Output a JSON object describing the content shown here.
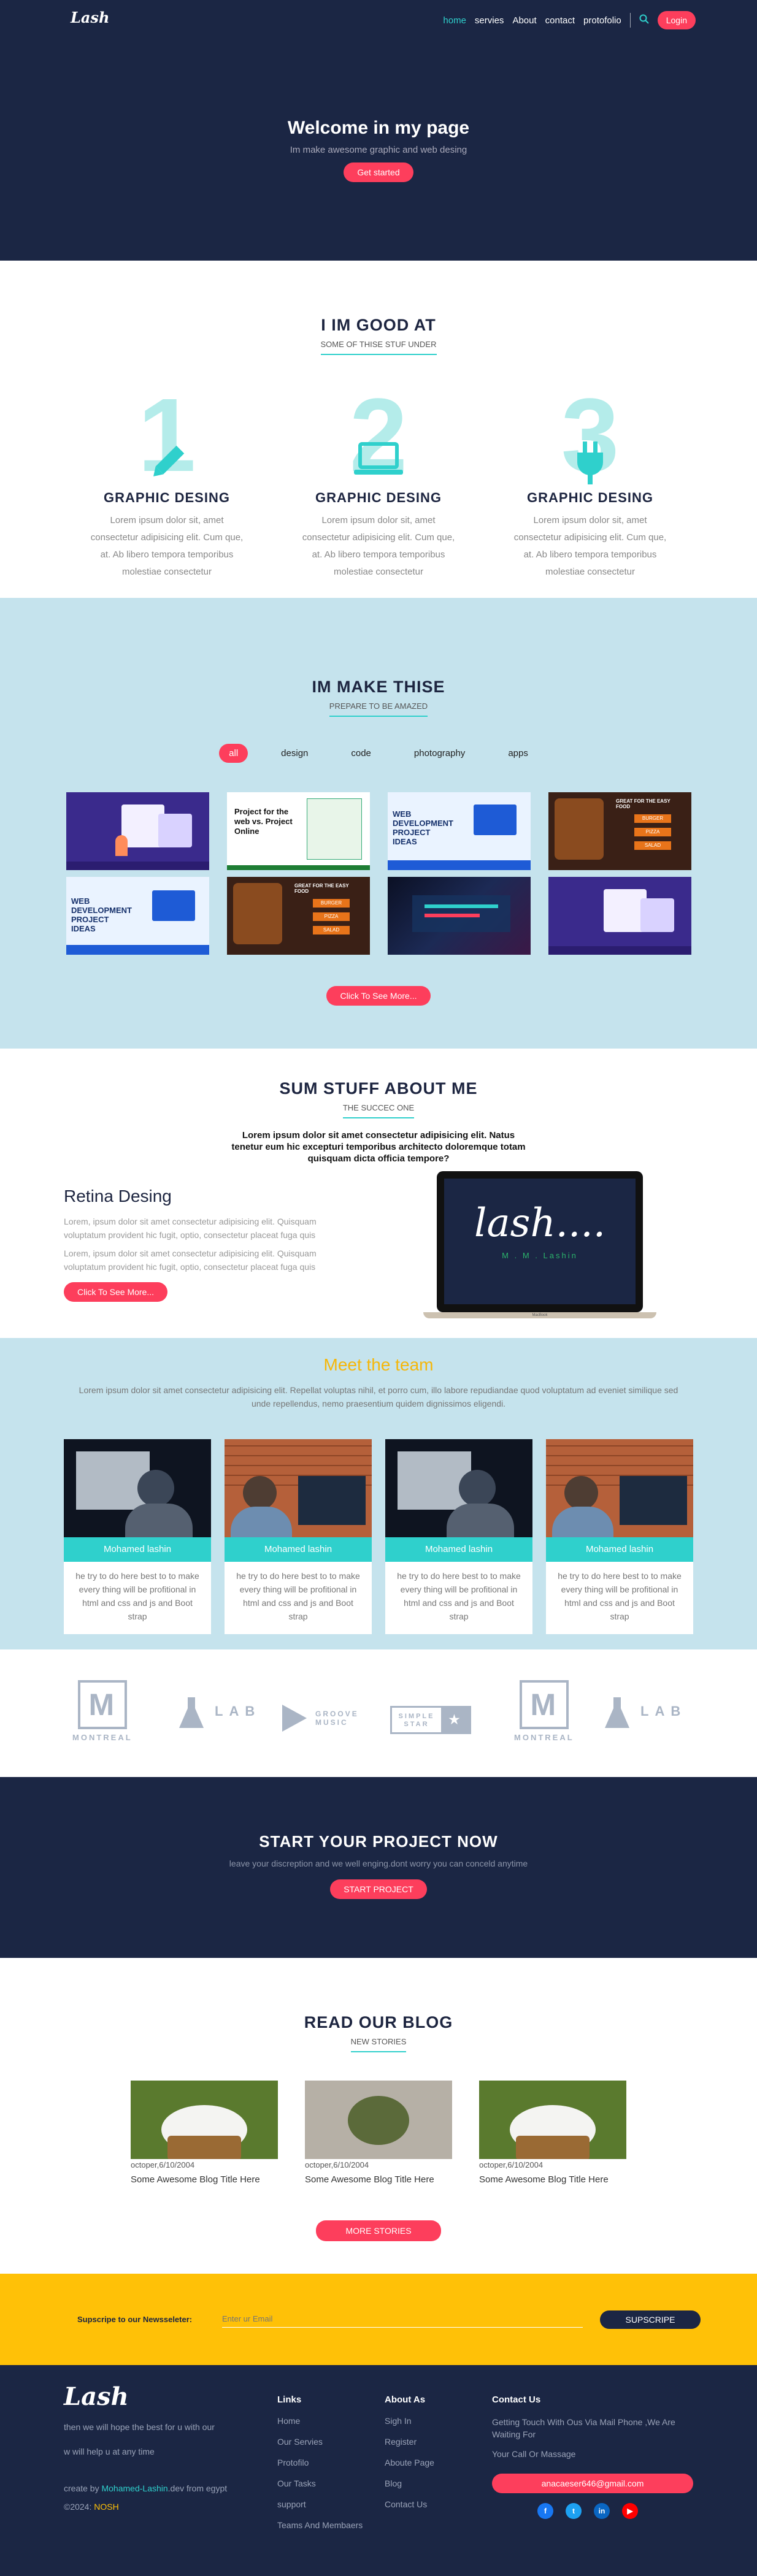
{
  "header": {
    "logo": "Lash",
    "nav": [
      "home",
      "servies",
      "About",
      "contact",
      "protofolio"
    ],
    "login_label": "Login",
    "title": "Welcome in my page",
    "subtitle": "Im make awesome graphic and web desing",
    "cta": "Get started"
  },
  "good": {
    "title": "I IM GOOD AT",
    "subtitle": "SOME OF THISE STUF UNDER",
    "features": [
      {
        "num": "1",
        "title": "GRAPHIC DESING",
        "text": "Lorem ipsum dolor sit, amet consectetur adipisicing elit. Cum que, at. Ab libero tempora temporibus molestiae consectetur"
      },
      {
        "num": "2",
        "title": "GRAPHIC DESING",
        "text": "Lorem ipsum dolor sit, amet consectetur adipisicing elit. Cum que, at. Ab libero tempora temporibus molestiae consectetur"
      },
      {
        "num": "3",
        "title": "GRAPHIC DESING",
        "text": "Lorem ipsum dolor sit, amet consectetur adipisicing elit. Cum que, at. Ab libero tempora temporibus molestiae consectetur"
      }
    ]
  },
  "portfolio": {
    "title": "IM MAKE THISE",
    "subtitle": "PREPARE TO BE AMAZED",
    "tabs": [
      "all",
      "design",
      "code",
      "photography",
      "apps"
    ],
    "tile_texts": {
      "project": "Project for the web vs. Project Online",
      "webdev": "WEB DEVELOPMENT PROJECT IDEAS",
      "food": "GREAT FOR THE EASY FOOD",
      "menu": [
        "BURGER",
        "PIZZA",
        "SALAD"
      ]
    },
    "more": "Click To See More..."
  },
  "about": {
    "title": "SUM STUFF ABOUT ME",
    "subtitle": "THE SUCCEC ONE",
    "intro": "Lorem ipsum dolor sit amet consectetur adipisicing elit. Natus tenetur eum hic excepturi temporibus architecto doloremque totam quisquam dicta officia tempore?",
    "heading": "Retina Desing",
    "p1": "Lorem, ipsum dolor sit amet consectetur adipisicing elit. Quisquam voluptatum provident hic fugit, optio, consectetur placeat fuga quis",
    "p2": "Lorem, ipsum dolor sit amet consectetur adipisicing elit. Quisquam voluptatum provident hic fugit, optio, consectetur placeat fuga quis",
    "more": "Click To See More...",
    "laptop_text": "lash....",
    "laptop_sub": "M . M . Lashin",
    "laptop_brand": "MacBook"
  },
  "team": {
    "title": "Meet the team",
    "intro": "Lorem ipsum dolor sit amet consectetur adipisicing elit. Repellat voluptas nihil, et porro cum, illo labore repudiandae quod voluptatum ad eveniet similique sed unde repellendus, nemo praesentium quidem dignissimos eligendi.",
    "members": [
      {
        "name": "Mohamed lashin",
        "text": "he try to do here best to to make every thing will be profitional in html and css and js and Boot strap"
      },
      {
        "name": "Mohamed lashin",
        "text": "he try to do here best to to make every thing will be profitional in html and css and js and Boot strap"
      },
      {
        "name": "Mohamed lashin",
        "text": "he try to do here best to to make every thing will be profitional in html and css and js and Boot strap"
      },
      {
        "name": "Mohamed lashin",
        "text": "he try to do here best to to make every thing will be profitional in html and css and js and Boot strap"
      }
    ]
  },
  "brands": [
    "MONTREAL",
    "LAB",
    "GROOVE MUSIC",
    "SIMPLE STAR",
    "MONTREAL",
    "LAB"
  ],
  "start": {
    "title": "START YOUR PROJECT NOW",
    "text": "leave your discreption and we well enging.dont worry you can conceld anytime",
    "cta": "START PROJECT"
  },
  "blog": {
    "title": "READ OUR BLOG",
    "subtitle": "NEW STORIES",
    "posts": [
      {
        "date": "octoper,6/10/2004",
        "title": "Some Awesome Blog Title Here"
      },
      {
        "date": "octoper,6/10/2004",
        "title": "Some Awesome Blog Title Here"
      },
      {
        "date": "octoper,6/10/2004",
        "title": "Some Awesome Blog Title Here"
      }
    ],
    "more": "MORE STORIES"
  },
  "newsletter": {
    "label": "Supscripe to our Newsseleter:",
    "placeholder": "Enter ur Email",
    "button": "SUPSCRIPE"
  },
  "footer": {
    "logo": "Lash",
    "about1": "then we will hope the best for u with our",
    "about2": "w will help u at any time",
    "credit_pre": "create by",
    "credit_name": "Mohamed-Lashin",
    "credit_post": ".dev from egypt",
    "copy_pre": "©2024:",
    "copy_name": "NOSH",
    "links_title": "Links",
    "links": [
      "Home",
      "Our Servies",
      "Protofilo",
      "Our Tasks",
      "support",
      "Teams And Membaers"
    ],
    "about_title": "About As",
    "about_links": [
      "Sigh In",
      "Register",
      "Aboute Page",
      "Blog",
      "Contact Us"
    ],
    "contact_title": "Contact Us",
    "contact_text": "Getting Touch With Ous Via Mail Phone ,We Are Waiting For",
    "contact_call": "Your Call Or Massage",
    "email": "anacaeser646@gmail.com",
    "social": [
      "f",
      "t",
      "in",
      "▶"
    ],
    "social_colors": [
      "#1877f2",
      "#1da1f2",
      "#0a66c2",
      "#ff0000"
    ]
  }
}
